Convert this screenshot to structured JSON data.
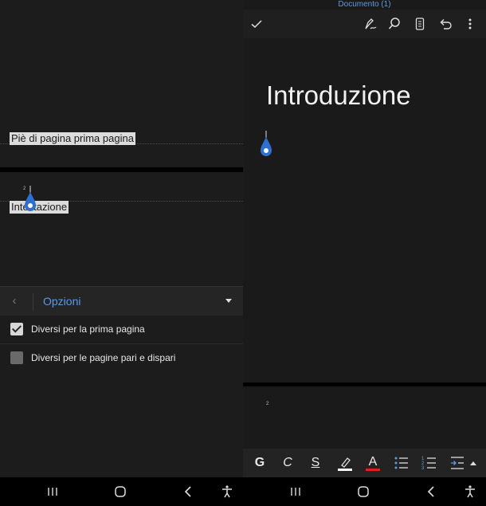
{
  "left_pane": {
    "footer_first_page_label": "Piè di pagina prima pagina",
    "header_label": "Intestazione",
    "page_number_small": "2",
    "options": {
      "title": "Opzioni",
      "back_icon": "chevron-left-icon",
      "dropdown_icon": "triangle-down-icon",
      "items": [
        {
          "label": "Diversi per la prima pagina",
          "checked": true
        },
        {
          "label": "Diversi per le pagine pari e dispari",
          "checked": false
        }
      ]
    }
  },
  "right_pane": {
    "document_title": "Documento (1)",
    "toolbar_icons": [
      "check-icon",
      "pen-icon",
      "search-icon",
      "mobile-view-icon",
      "undo-icon",
      "more-vertical-icon"
    ],
    "heading": "Introduzione",
    "page_number_small": "2",
    "format_bar": {
      "bold_label": "G",
      "italic_label": "C",
      "underline_label": "S",
      "highlight_color": "#ffffff",
      "font_color": "#e02020",
      "font_color_label": "A",
      "icons": [
        "bold-icon",
        "italic-icon",
        "underline-icon",
        "highlighter-icon",
        "font-color-icon",
        "bullet-list-icon",
        "numbered-list-icon",
        "indent-icon",
        "expand-up-icon"
      ]
    }
  },
  "navbar": {
    "icons": [
      "recent-apps-icon",
      "home-icon",
      "back-icon",
      "accessibility-icon"
    ]
  },
  "colors": {
    "accent": "#5b9ae8",
    "handle": "#2f6fd0",
    "background": "#1c1c1c"
  }
}
